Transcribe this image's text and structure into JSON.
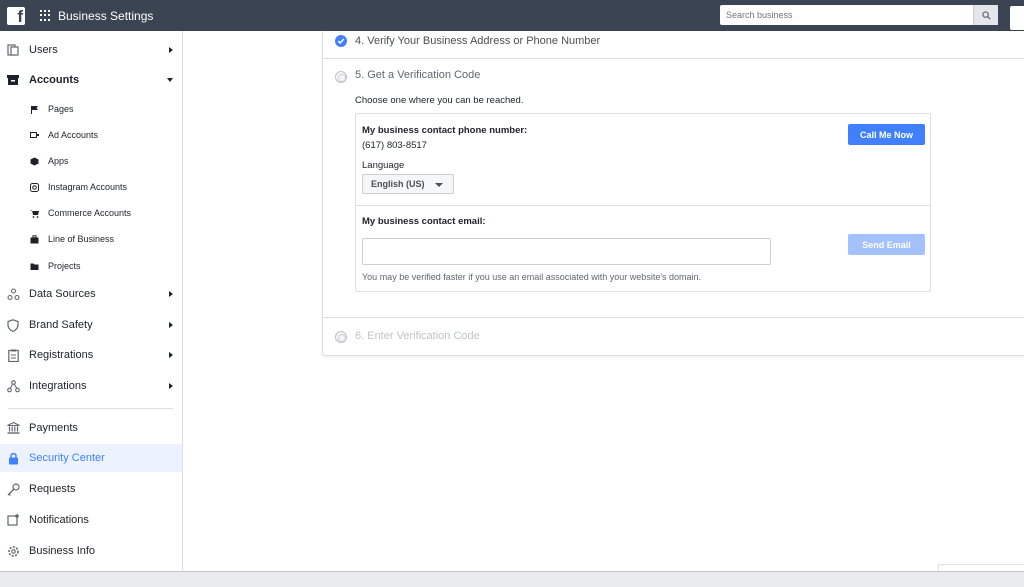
{
  "header": {
    "app_title": "Business Settings",
    "search_placeholder": "Search business"
  },
  "sidebar": {
    "items": [
      {
        "label": "Users",
        "icon": "users-icon"
      },
      {
        "label": "Accounts",
        "icon": "accounts-icon"
      },
      {
        "label": "Data Sources",
        "icon": "data-sources-icon"
      },
      {
        "label": "Brand Safety",
        "icon": "shield-icon"
      },
      {
        "label": "Registrations",
        "icon": "registrations-icon"
      },
      {
        "label": "Integrations",
        "icon": "integrations-icon"
      },
      {
        "label": "Payments",
        "icon": "bank-icon"
      },
      {
        "label": "Security Center",
        "icon": "lock-icon"
      },
      {
        "label": "Requests",
        "icon": "key-icon"
      },
      {
        "label": "Notifications",
        "icon": "notification-icon"
      },
      {
        "label": "Business Info",
        "icon": "gear-icon"
      }
    ],
    "sub_items": [
      {
        "label": "Pages",
        "icon": "flag-icon"
      },
      {
        "label": "Ad Accounts",
        "icon": "ad-accounts-icon"
      },
      {
        "label": "Apps",
        "icon": "cube-icon"
      },
      {
        "label": "Instagram Accounts",
        "icon": "instagram-icon"
      },
      {
        "label": "Commerce Accounts",
        "icon": "cart-icon"
      },
      {
        "label": "Line of Business",
        "icon": "briefcase-icon"
      },
      {
        "label": "Projects",
        "icon": "folder-icon"
      }
    ]
  },
  "verification": {
    "step4_label": "4. Verify Your Business Address or Phone Number",
    "step5_label": "5. Get a Verification Code",
    "choose_text": "Choose one where you can be reached.",
    "phone_label": "My business contact phone number:",
    "phone_value": "(617) 803-8517",
    "language_label": "Language",
    "language_value": "English (US)",
    "call_button": "Call Me Now",
    "email_label": "My business contact email:",
    "email_value": "",
    "send_button": "Send Email",
    "email_hint": "You may be verified faster if you use an email associated with your website's domain.",
    "step6_label": "6. Enter Verification Code"
  },
  "colors": {
    "topbar": "#3b4452",
    "accent": "#4080ff",
    "active_bg": "#ecf3ff",
    "disabled_button": "#a3c1fb"
  }
}
